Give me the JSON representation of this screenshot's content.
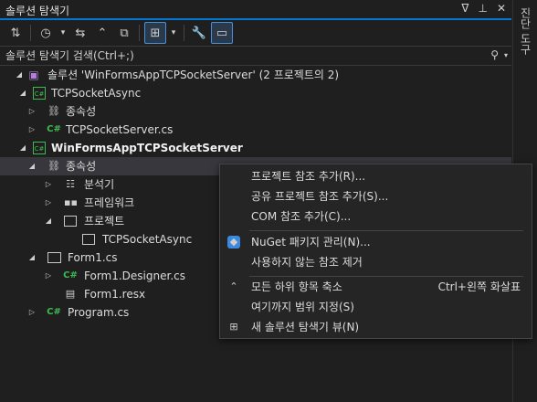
{
  "panel": {
    "title": "솔루션 탐색기",
    "pin_glyph": "ᐁ",
    "pin2_glyph": "⊥",
    "close_glyph": "✕",
    "side_tab": "진단 도구"
  },
  "toolbar": {
    "sync_glyph": "⇅",
    "history_glyph": "◷",
    "dropdown_glyph": "▾",
    "switch_glyph": "⇆",
    "collapse_glyph": "⌃",
    "copy_glyph": "⧉",
    "tree_glyph": "⊞",
    "wrench_glyph": "🔧",
    "preview_glyph": "▭"
  },
  "search": {
    "placeholder": "솔루션 탐색기 검색(Ctrl+;)",
    "search_glyph": "⚲",
    "dropdown_glyph": "▾"
  },
  "glyphs": {
    "expanded": "◢",
    "collapsed": "▷",
    "cs": "C#",
    "deps": "⛓",
    "sln": "▣",
    "file": "▤",
    "analyzer": "☷",
    "framework": "▪▪"
  },
  "tree": [
    {
      "label": "솔루션 'WinFormsAppTCPSocketServer'  (2 프로젝트의 2)"
    },
    {
      "label": "TCPSocketAsync"
    },
    {
      "label": "종속성"
    },
    {
      "label": "TCPSocketServer.cs"
    },
    {
      "label": "WinFormsAppTCPSocketServer"
    },
    {
      "label": "종속성"
    },
    {
      "label": "분석기"
    },
    {
      "label": "프레임워크"
    },
    {
      "label": "프로젝트"
    },
    {
      "label": "TCPSocketAsync"
    },
    {
      "label": "Form1.cs"
    },
    {
      "label": "Form1.Designer.cs"
    },
    {
      "label": "Form1.resx"
    },
    {
      "label": "Program.cs"
    }
  ],
  "context_menu": {
    "items": [
      {
        "label": "프로젝트 참조 추가(R)...",
        "shortcut": ""
      },
      {
        "label": "공유 프로젝트 참조 추가(S)...",
        "shortcut": ""
      },
      {
        "label": "COM 참조 추가(C)...",
        "shortcut": ""
      },
      {
        "label": "NuGet 패키지 관리(N)...",
        "shortcut": ""
      },
      {
        "label": "사용하지 않는 참조 제거",
        "shortcut": ""
      },
      {
        "label": "모든 하위 항목 축소",
        "shortcut": "Ctrl+왼쪽 화살표"
      },
      {
        "label": "여기까지 범위 지정(S)",
        "shortcut": ""
      },
      {
        "label": "새 솔루션 탐색기 뷰(N)",
        "shortcut": ""
      }
    ],
    "icons": {
      "nuget": "◆",
      "collapse": "⌃",
      "new_view": "⊞"
    }
  }
}
